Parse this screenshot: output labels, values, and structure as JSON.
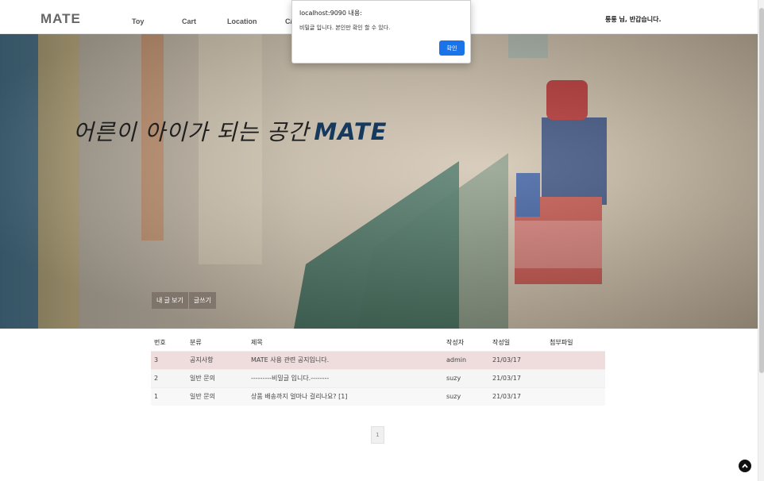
{
  "header": {
    "logo": "MATE",
    "nav": [
      "Toy",
      "Cart",
      "Location",
      "C/"
    ],
    "greeting": "룽룽 님, 반갑습니다."
  },
  "hero": {
    "slogan": "어른이 아이가 되는 공간",
    "slogan_brand": "MATE",
    "my_posts_button": "내 글 보기",
    "write_button": "글쓰기"
  },
  "board": {
    "columns": [
      "번호",
      "분류",
      "제목",
      "작성자",
      "작성일",
      "첨부파일"
    ],
    "rows": [
      {
        "no": "3",
        "category": "공지사항",
        "title": "MATE 사용 관련 공지입니다.",
        "author": "admin",
        "date": "21/03/17",
        "file": ""
      },
      {
        "no": "2",
        "category": "일반 문의",
        "title": "---------비밀글 입니다.--------",
        "author": "suzy",
        "date": "21/03/17",
        "file": ""
      },
      {
        "no": "1",
        "category": "일반 문의",
        "title": "상품 배송까지 얼마나 걸리나요? [1]",
        "author": "suzy",
        "date": "21/03/17",
        "file": ""
      }
    ]
  },
  "pagination": {
    "current": "1"
  },
  "dialog": {
    "title": "localhost:9090 내용:",
    "message": "비밀글 입니다. 본인만 확인 할 수 있다.",
    "ok_button": "확인"
  },
  "colors": {
    "accent": "#1a73e8",
    "brand": "#16395e",
    "notice_row": "#efdcdc"
  }
}
